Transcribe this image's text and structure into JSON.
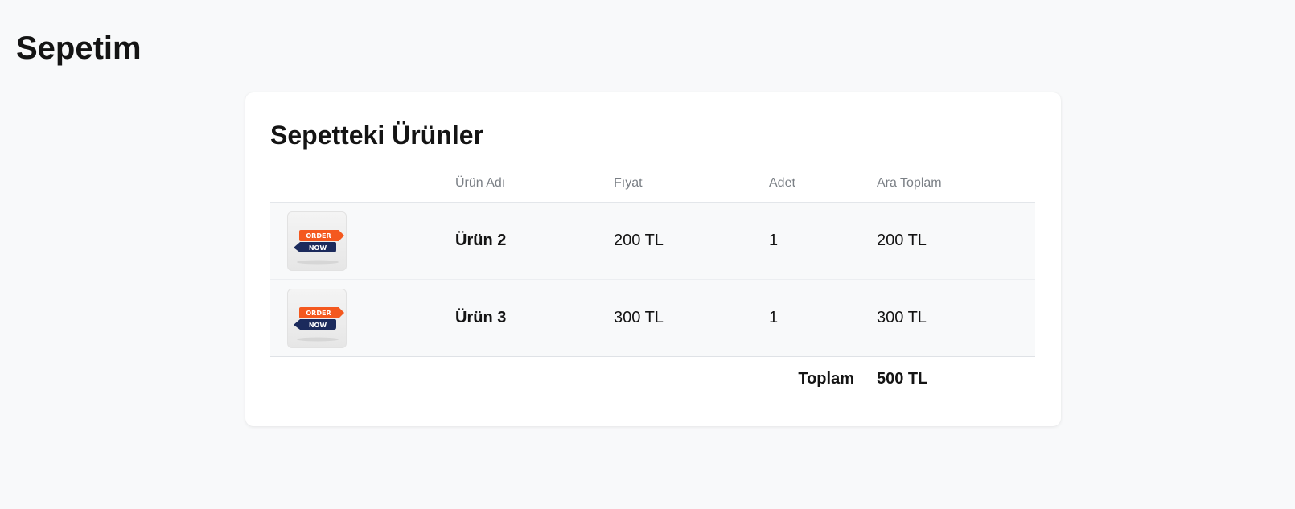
{
  "page": {
    "title": "Sepetim"
  },
  "cart": {
    "title": "Sepetteki Ürünler",
    "columns": {
      "image": "",
      "name": "Ürün Adı",
      "price": "Fıyat",
      "quantity": "Adet",
      "subtotal": "Ara Toplam"
    },
    "items": [
      {
        "image_icon": "order-now-badge",
        "image_text_top": "ORDER",
        "image_text_bottom": "NOW",
        "name": "Ürün 2",
        "price": "200 TL",
        "quantity": "1",
        "subtotal": "200 TL"
      },
      {
        "image_icon": "order-now-badge",
        "image_text_top": "ORDER",
        "image_text_bottom": "NOW",
        "name": "Ürün 3",
        "price": "300 TL",
        "quantity": "1",
        "subtotal": "300 TL"
      }
    ],
    "total_label": "Toplam",
    "total_value": "500 TL"
  },
  "colors": {
    "page_background": "#f8f9fa",
    "card_background": "#ffffff",
    "row_background": "#f8f9fa",
    "header_text": "#7a7f85",
    "badge_orange": "#f4581e",
    "badge_navy": "#1b2a5c"
  }
}
